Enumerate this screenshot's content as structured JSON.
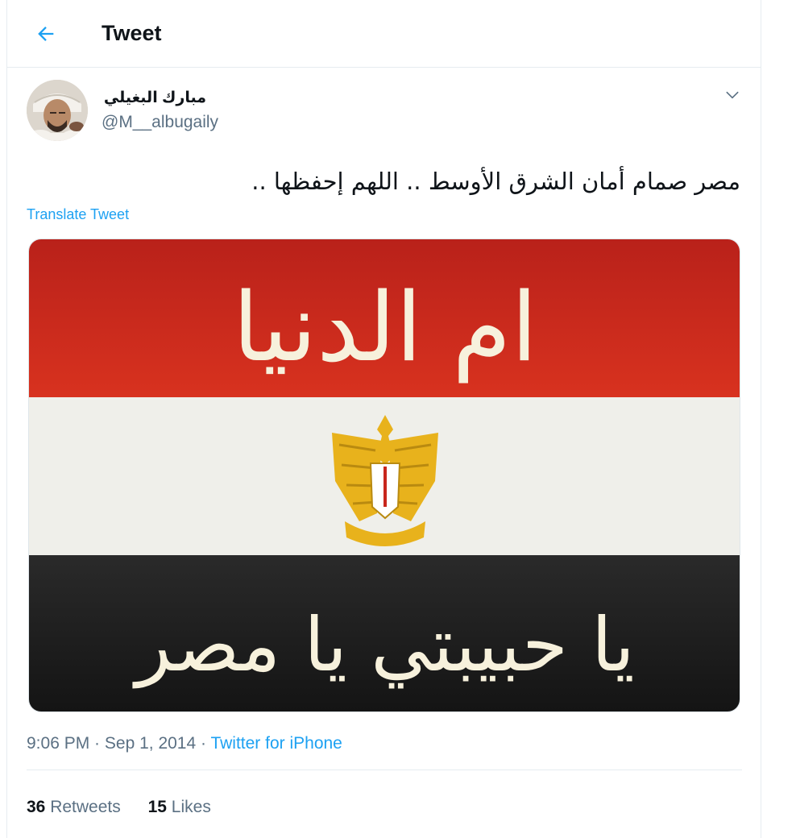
{
  "header": {
    "title": "Tweet",
    "back_icon": "arrow-left-icon",
    "accent_color": "#1da1f2"
  },
  "author": {
    "display_name": "مبارك البغيلي",
    "handle": "@M__albugaily"
  },
  "tweet": {
    "text": "مصر صمام أمان الشرق الأوسط .. اللهم إحفظها ..",
    "translate_label": "Translate Tweet"
  },
  "media": {
    "top_text": "ام الدنيا",
    "bottom_text": "يا حبيبتي يا مصر",
    "flag_colors": [
      "#c8261c",
      "#f2f2ee",
      "#1c1c1c"
    ],
    "emblem_color": "#e8b21c"
  },
  "meta": {
    "time": "9:06 PM",
    "separator": " · ",
    "date": "Sep 1, 2014",
    "source": "Twitter for iPhone"
  },
  "stats": {
    "retweets_count": "36",
    "retweets_label": "Retweets",
    "likes_count": "15",
    "likes_label": "Likes"
  }
}
